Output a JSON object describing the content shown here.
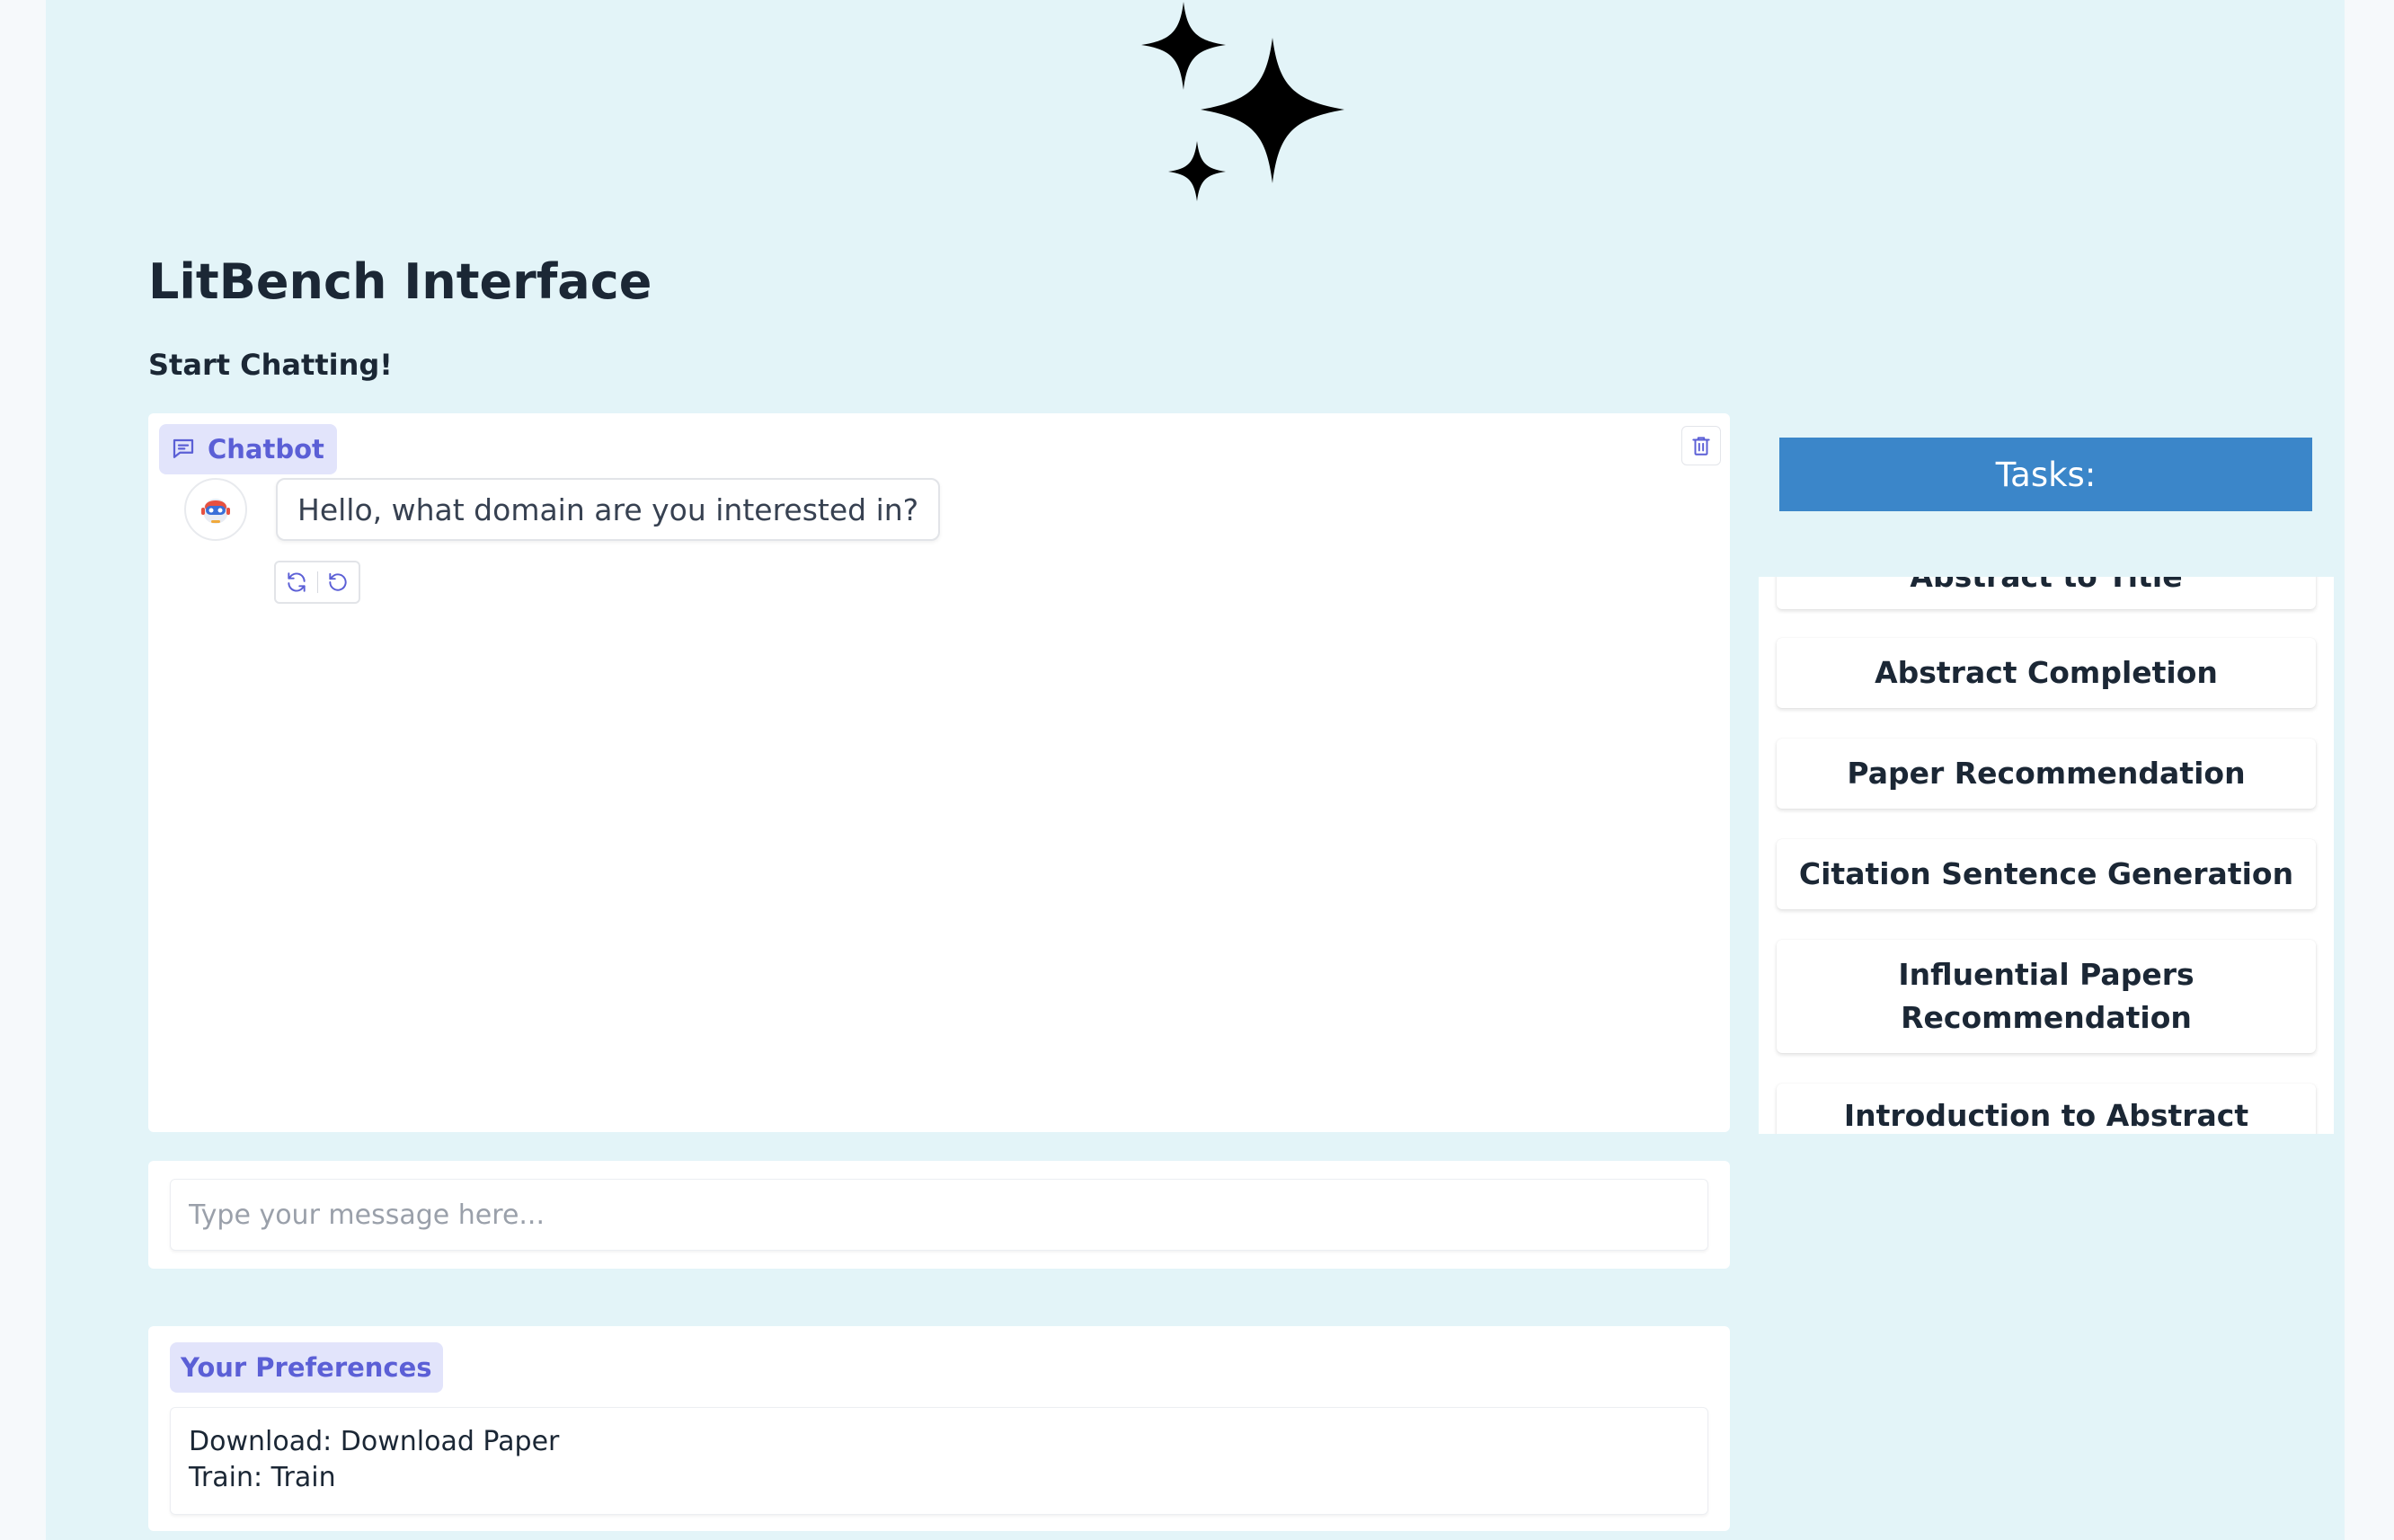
{
  "app": {
    "title": "LitBench Interface",
    "subtitle": "Start Chatting!"
  },
  "chatbot": {
    "label": "Chatbot",
    "messages": [
      {
        "role": "assistant",
        "text": "Hello, what domain are you interested in?"
      }
    ]
  },
  "input": {
    "placeholder": "Type your message here..."
  },
  "preferences": {
    "label": "Your Preferences",
    "lines": [
      "Download: Download Paper",
      "Train: Train"
    ]
  },
  "tasks": {
    "header": "Tasks:",
    "items": [
      "Abstract to Title",
      "Abstract Completion",
      "Paper Recommendation",
      "Citation Sentence Generation",
      "Influential Papers Recommendation",
      "Introduction to Abstract"
    ]
  },
  "colors": {
    "background": "#e3f4f8",
    "accent": "#5b5fd6",
    "tasks_header": "#3b86c9"
  },
  "icons": {
    "logo": "sparkles-icon",
    "chatbot": "chat-bubble-icon",
    "clear": "trash-icon",
    "retry": "refresh-icon",
    "undo": "undo-icon"
  }
}
